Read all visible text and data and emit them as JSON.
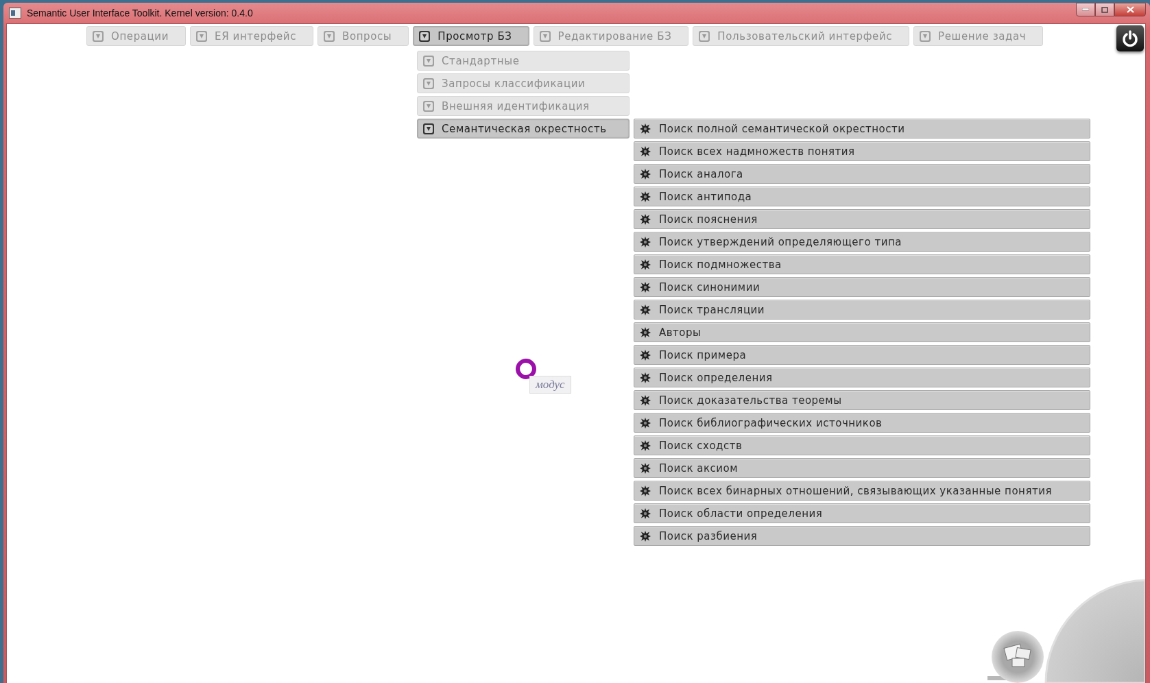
{
  "window": {
    "title": "Semantic User Interface Toolkit. Kernel version: 0.4.0"
  },
  "menu": [
    {
      "label": "Операции",
      "selected": false
    },
    {
      "label": "ЕЯ интерфейс",
      "selected": false
    },
    {
      "label": "Вопросы",
      "selected": false
    },
    {
      "label": "Просмотр БЗ",
      "selected": true
    },
    {
      "label": "Редактирование БЗ",
      "selected": false
    },
    {
      "label": "Пользовательский интерфейс",
      "selected": false
    },
    {
      "label": "Решение задач",
      "selected": false
    }
  ],
  "submenu": [
    {
      "label": "Стандартные",
      "selected": false
    },
    {
      "label": "Запросы классификации",
      "selected": false
    },
    {
      "label": "Внешняя идентификация",
      "selected": false
    },
    {
      "label": "Семантическая окрестность",
      "selected": true
    }
  ],
  "commands": [
    {
      "label": "Поиск полной семантической окрестности"
    },
    {
      "label": "Поиск всех надмножеств понятия"
    },
    {
      "label": "Поиск аналога"
    },
    {
      "label": "Поиск антипода"
    },
    {
      "label": "Поиск пояснения"
    },
    {
      "label": "Поиск утверждений определяющего типа"
    },
    {
      "label": "Поиск подмножества"
    },
    {
      "label": "Поиск синонимии"
    },
    {
      "label": "Поиск трансляции"
    },
    {
      "label": "Авторы"
    },
    {
      "label": "Поиск примера"
    },
    {
      "label": "Поиск определения"
    },
    {
      "label": "Поиск доказательства теоремы"
    },
    {
      "label": "Поиск библиографических источников"
    },
    {
      "label": "Поиск сходств"
    },
    {
      "label": "Поиск аксиом"
    },
    {
      "label": "Поиск всех бинарных отношений, связывающих указанные понятия"
    },
    {
      "label": "Поиск области определения"
    },
    {
      "label": "Поиск разбиения"
    }
  ],
  "node": {
    "label": "модус"
  }
}
